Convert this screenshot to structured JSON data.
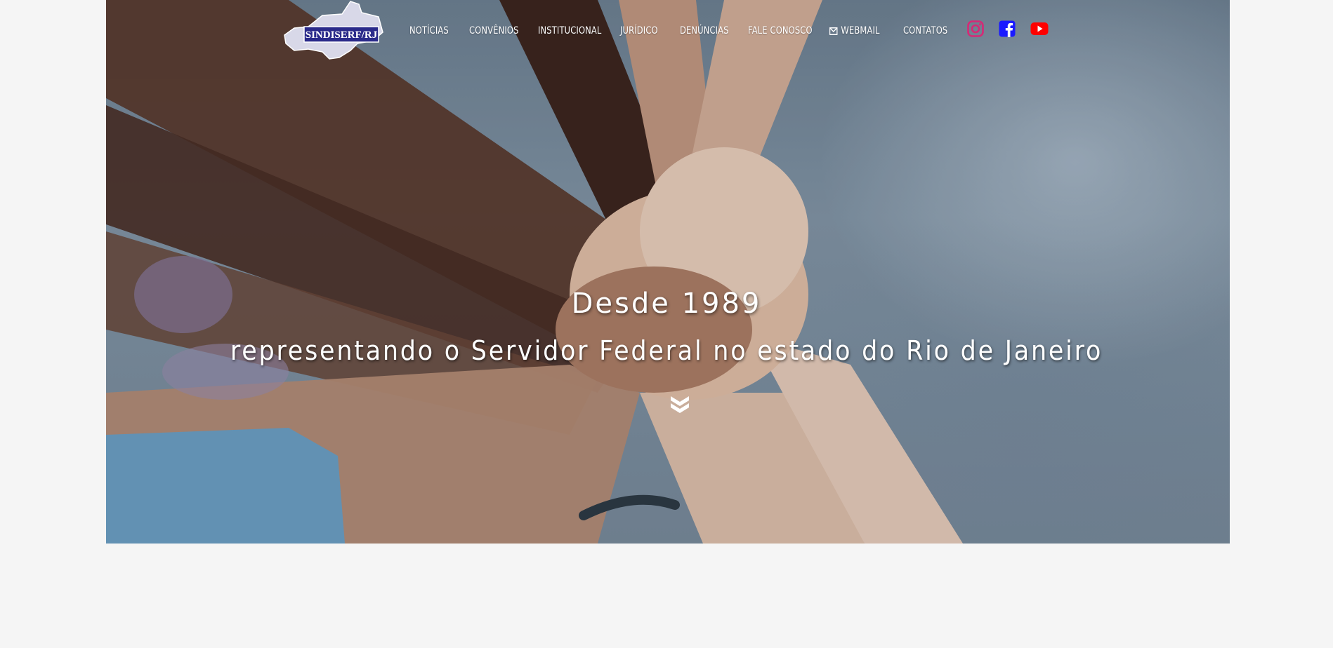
{
  "brand": {
    "logo_text": "SINDISERF/RJ"
  },
  "nav": {
    "items": [
      {
        "label": "NOTÍCIAS"
      },
      {
        "label": "CONVÊNIOS"
      },
      {
        "label": "INSTITUCIONAL"
      },
      {
        "label": "JURÍDICO"
      },
      {
        "label": "DENÚNCIAS"
      },
      {
        "label": "FALE CONOSCO"
      },
      {
        "label": "WEBMAIL",
        "icon": "envelope-icon"
      },
      {
        "label": "CONTATOS"
      }
    ]
  },
  "social": [
    {
      "icon": "instagram-icon",
      "color": "#d62976"
    },
    {
      "icon": "facebook-icon",
      "color": "#1a1aff"
    },
    {
      "icon": "youtube-icon",
      "color": "#ff0000"
    }
  ],
  "hero": {
    "line1": "Desde 1989",
    "line2": "representando o Servidor Federal no estado do Rio de Janeiro",
    "scroll_icon": "double-chevron-down-icon"
  },
  "colors": {
    "page_bg": "#f5f5f5",
    "nav_text": "#ffffff",
    "logo_blue": "#2a2a8a"
  }
}
